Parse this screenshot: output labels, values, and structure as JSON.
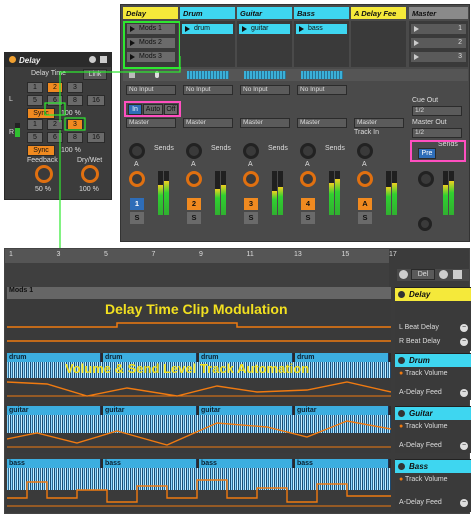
{
  "device": {
    "title": "Delay",
    "delay_time_label": "Delay Time",
    "link_label": "Link",
    "left_label": "L",
    "right_label": "R",
    "left_row1": [
      "1",
      "2",
      "3"
    ],
    "left_row2": [
      "5",
      "6",
      "8",
      "16"
    ],
    "right_row1": [
      "1",
      "2",
      "3"
    ],
    "right_row2": [
      "5",
      "6",
      "8",
      "16"
    ],
    "sync_label": "Sync",
    "left_value": "100 %",
    "right_value": "100 %",
    "feedback_label": "Feedback",
    "drywet_label": "Dry/Wet",
    "feedback_value": "50 %",
    "drywet_value": "100 %"
  },
  "mixer": {
    "tracks": [
      {
        "name": "Delay",
        "color": "#f5e93a"
      },
      {
        "name": "Drum",
        "color": "#3ed6f0"
      },
      {
        "name": "Guitar",
        "color": "#3ed6f0"
      },
      {
        "name": "Bass",
        "color": "#3ed6f0"
      },
      {
        "name": "A Delay Fee",
        "color": "#f5e93a"
      },
      {
        "name": "Master",
        "color": "#8a8a8a"
      }
    ],
    "delay_clips": [
      "Mods 1",
      "Mods 2",
      "Mods 3"
    ],
    "drum_clip": "drum",
    "guitar_clip": "guitar",
    "bass_clip": "bass",
    "master_scenes": [
      "1",
      "2",
      "3"
    ],
    "input_label": "No Input",
    "monitor": [
      "In",
      "Auto",
      "Off"
    ],
    "output_label": "Master",
    "track_in_label": "Track In",
    "cue_out_label": "Cue Out",
    "cue_out_value": "1/2",
    "master_out_label": "Master Out",
    "master_out_value": "1/2",
    "sends_label": "Sends",
    "pre_label": "Pre",
    "send_letter": "A",
    "track_numbers": [
      "1",
      "2",
      "3",
      "4"
    ],
    "return_letter": "A",
    "solo_label": "S"
  },
  "arrangement": {
    "ruler": [
      "1",
      "3",
      "5",
      "7",
      "9",
      "11",
      "13",
      "15",
      "17"
    ],
    "mods_clip": "Mods 1",
    "callout_delay": "Delay Time Clip Modulation",
    "callout_volume": "Volume & Send Level Track Automation",
    "drum_clips": [
      "drum",
      "drum",
      "drum",
      "drum"
    ],
    "guitar_clips": [
      "guitar",
      "guitar",
      "guitar",
      "guitar"
    ],
    "bass_clips": [
      "bass",
      "bass",
      "bass",
      "bass"
    ],
    "del_label": "Del",
    "right_panel": {
      "delay_name": "Delay",
      "delay_params": [
        "L Beat Delay",
        "R Beat Delay"
      ],
      "drum_name": "Drum",
      "drum_params": [
        "Track Volume",
        "A-Delay Feed"
      ],
      "guitar_name": "Guitar",
      "guitar_params": [
        "Track Volume",
        "A-Delay Feed"
      ],
      "bass_name": "Bass",
      "bass_params": [
        "Track Volume",
        "A-Delay Feed"
      ]
    }
  },
  "colors": {
    "highlight_green": "#2ee830",
    "highlight_pink": "#ff4fc0",
    "callout_yellow": "#f2e020",
    "automation_orange": "#f07a10",
    "clip_blue": "#3caee0"
  }
}
